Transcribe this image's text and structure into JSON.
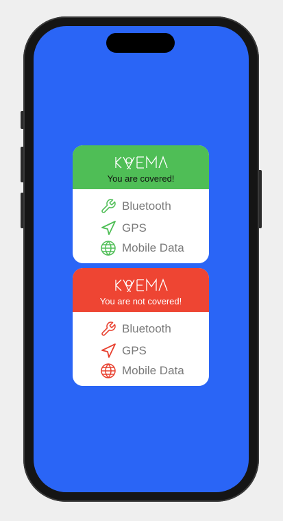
{
  "brand": "KVEMA",
  "cards": [
    {
      "status": "You are covered!",
      "accent": "#4fbe56",
      "items": [
        {
          "label": "Bluetooth",
          "icon": "wrench-icon"
        },
        {
          "label": "GPS",
          "icon": "location-arrow-icon"
        },
        {
          "label": "Mobile Data",
          "icon": "globe-icon"
        }
      ]
    },
    {
      "status": "You are not covered!",
      "accent": "#ee4533",
      "items": [
        {
          "label": "Bluetooth",
          "icon": "wrench-icon"
        },
        {
          "label": "GPS",
          "icon": "location-arrow-icon"
        },
        {
          "label": "Mobile Data",
          "icon": "globe-icon"
        }
      ]
    }
  ],
  "colors": {
    "screen_background": "#2a65f6",
    "label": "#7a7a7a"
  }
}
